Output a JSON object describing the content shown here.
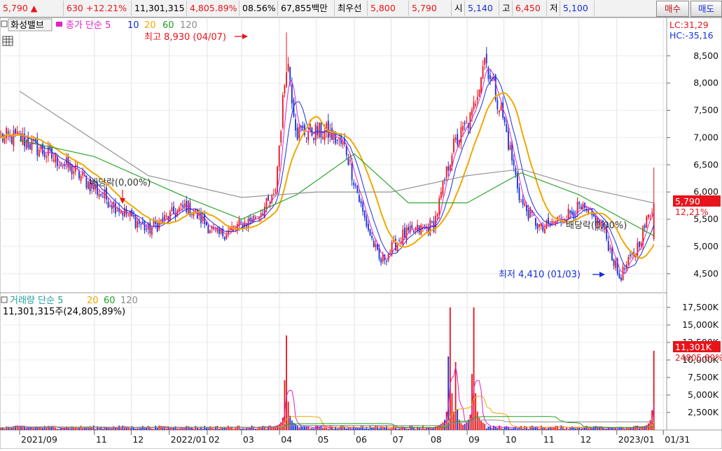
{
  "ticker": {
    "price": "5,790",
    "up_arrow": "▲",
    "change": "630",
    "change_pct": "+12.21%",
    "volume": "11,301,315",
    "volume_ratio": "4,805.89%",
    "turnover_pct": "08.56%",
    "trade_value": "67,855백만",
    "best_ask_label": "최우선",
    "best_ask": "5,800",
    "best_bid": "5,790",
    "open_label": "시",
    "open": "5,140",
    "high_label": "고",
    "high": "6,450",
    "low_label": "저",
    "low": "5,100",
    "buy_button": "매수",
    "sell_button": "매도"
  },
  "price_panel": {
    "stock_name": "화성밸브",
    "legend_prefix": "종가 단순 5",
    "ma_labels": [
      "10",
      "20",
      "60",
      "120"
    ],
    "lc_label": "LC:31,29",
    "hc_label": "HC:-35,16",
    "current_tag": "5,790",
    "current_pct": "12,21%",
    "y_ticks": [
      "8,500",
      "8,000",
      "7,500",
      "7,000",
      "6,500",
      "6,000",
      "5,500",
      "5,000",
      "4,500"
    ],
    "annotations": {
      "high": "최고 8,930 (04/07)",
      "low": "최저 4,410 (01/03)",
      "dividend1": "배당락(0,00%)",
      "dividend2": "배당락(0,00%)"
    }
  },
  "volume_panel": {
    "legend_prefix": "거래량 단순 5",
    "ma_labels": [
      "20",
      "60",
      "120"
    ],
    "volume_text": "11,301,315주(24,805,89%)",
    "current_tag": "11,301K",
    "current_pct": "24805,89%",
    "y_ticks": [
      "17,500K",
      "15,000K",
      "12,500K",
      "10,000K",
      "7,500K",
      "5,000K",
      "2,500K"
    ]
  },
  "x_axis": {
    "labels": [
      "2021/09",
      "11",
      "12",
      "2022/01",
      "02",
      "03",
      "04",
      "05",
      "06",
      "07",
      "08",
      "09",
      "10",
      "11",
      "12",
      "2023/01",
      "01/31"
    ]
  },
  "colors": {
    "up": "#e8141b",
    "down": "#1630d8",
    "ma5": "#e020c8",
    "ma10": "#1630d8",
    "ma20": "#f0a800",
    "ma60": "#20a020",
    "ma120": "#8c8c8c"
  },
  "chart_data": [
    {
      "type": "line",
      "title": "",
      "series": [
        {
          "name": "종가",
          "x": [
            "2021/09/01",
            "2021/10/15",
            "2021/11/15",
            "2021/12/15",
            "2022/01/15",
            "2022/02/10",
            "2022/03/10",
            "2022/03/28",
            "2022/04/07",
            "2022/04/15",
            "2022/05/10",
            "2022/05/25",
            "2022/06/08",
            "2022/06/22",
            "2022/07/10",
            "2022/08/05",
            "2022/08/20",
            "2022/09/05",
            "2022/09/15",
            "2022/10/01",
            "2022/10/15",
            "2022/11/01",
            "2022/11/15",
            "2022/12/01",
            "2022/12/20",
            "2023/01/03",
            "2023/01/16",
            "2023/01/31"
          ],
          "values": [
            7000,
            6400,
            5800,
            5300,
            5750,
            5200,
            5500,
            5900,
            8500,
            7100,
            7100,
            6800,
            5600,
            4700,
            5200,
            5400,
            6800,
            7400,
            8500,
            7300,
            5800,
            5300,
            5500,
            5700,
            5400,
            4420,
            4900,
            5790
          ]
        },
        {
          "name": "120",
          "x": [
            "2021/09/01",
            "2021/12/15",
            "2022/03/01",
            "2022/05/01",
            "2022/07/01",
            "2022/09/01",
            "2022/10/15",
            "2022/12/01",
            "2023/01/31"
          ],
          "values": [
            7850,
            6300,
            5900,
            6000,
            6000,
            6300,
            6420,
            6100,
            5800
          ]
        },
        {
          "name": "60",
          "x": [
            "2021/09/01",
            "2021/11/01",
            "2022/01/15",
            "2022/03/01",
            "2022/04/15",
            "2022/06/01",
            "2022/07/15",
            "2022/09/01",
            "2022/10/15",
            "2022/12/01",
            "2023/01/31"
          ],
          "values": [
            6950,
            6650,
            5900,
            5500,
            5950,
            6700,
            5800,
            5800,
            6350,
            5950,
            5200
          ]
        }
      ],
      "annotations": [
        {
          "x": "2022/04/07",
          "y": 8930,
          "text": "최고 8,930 (04/07)"
        },
        {
          "x": "2023/01/03",
          "y": 4410,
          "text": "최저 4,410 (01/03)"
        }
      ],
      "ylim": [
        4150,
        9050
      ],
      "y_axis_position": "right"
    },
    {
      "type": "bar",
      "series": [
        {
          "name": "거래량",
          "x": [
            "2022/04/05",
            "2022/04/06",
            "2022/04/07",
            "2022/08/16",
            "2022/08/18",
            "2022/08/22",
            "2022/09/05",
            "2022/09/07",
            "2023/01/31"
          ],
          "values": [
            7100,
            13200,
            13500,
            10500,
            17500,
            9700,
            8000,
            17500,
            11301
          ]
        }
      ],
      "ylim": [
        0,
        18500
      ],
      "ylabel": "",
      "y_axis_position": "right"
    }
  ]
}
